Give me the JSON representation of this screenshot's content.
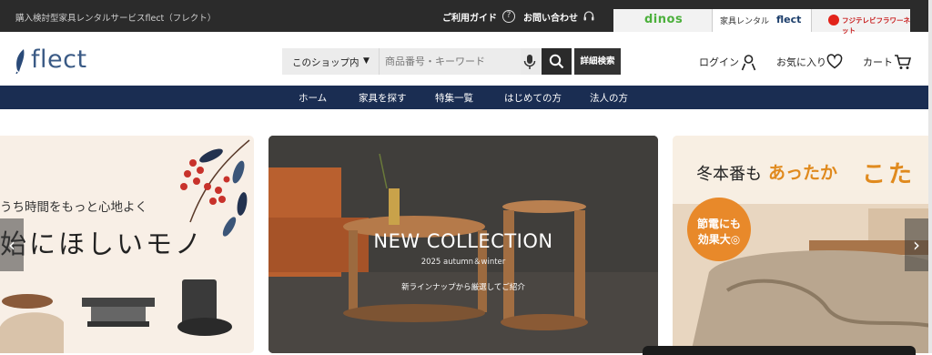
{
  "topbar": {
    "site_description": "購入検討型家具レンタルサービスflect（フレクト）",
    "guide_label": "ご利用ガイド",
    "guide_icon": "question-circle-icon",
    "contact_label": "お問い合わせ",
    "contact_icon": "headset-icon",
    "brand_tabs": {
      "dinos": "dinos",
      "flect_label": "家具レンタル",
      "flect_logo": "flect",
      "fuji": "フジテレビフラワーネット"
    },
    "colors": {
      "bar": "#2b2b2b",
      "dinos_green": "#4cb03c"
    }
  },
  "header": {
    "logo": "flect",
    "search": {
      "scope": "このショップ内",
      "placeholder": "商品番号・キーワード",
      "mic_icon": "microphone-icon",
      "search_icon": "search-icon"
    },
    "advanced_search": "詳細検索",
    "login": "ログイン",
    "favorites": "お気に入り",
    "cart": "カート"
  },
  "nav": {
    "items": [
      "ホーム",
      "家具を探す",
      "特集一覧",
      "はじめての方",
      "法人の方"
    ],
    "color": "#1a2d52"
  },
  "banners": {
    "left": {
      "tagline": "うち時間をもっと心地よく",
      "headline": "始にほしいモノ"
    },
    "center": {
      "title": "NEW COLLECTION",
      "subtitle": "2025 autumn＆winter",
      "description": "新ラインナップから厳選してご紹介"
    },
    "right": {
      "heading_part1": "冬本番も",
      "heading_part2": "あったか",
      "heading_part3": "こた",
      "badge_line1": "節電にも",
      "badge_line2": "効果大◎"
    },
    "prev_arrow": "‹",
    "next_arrow": "›"
  }
}
